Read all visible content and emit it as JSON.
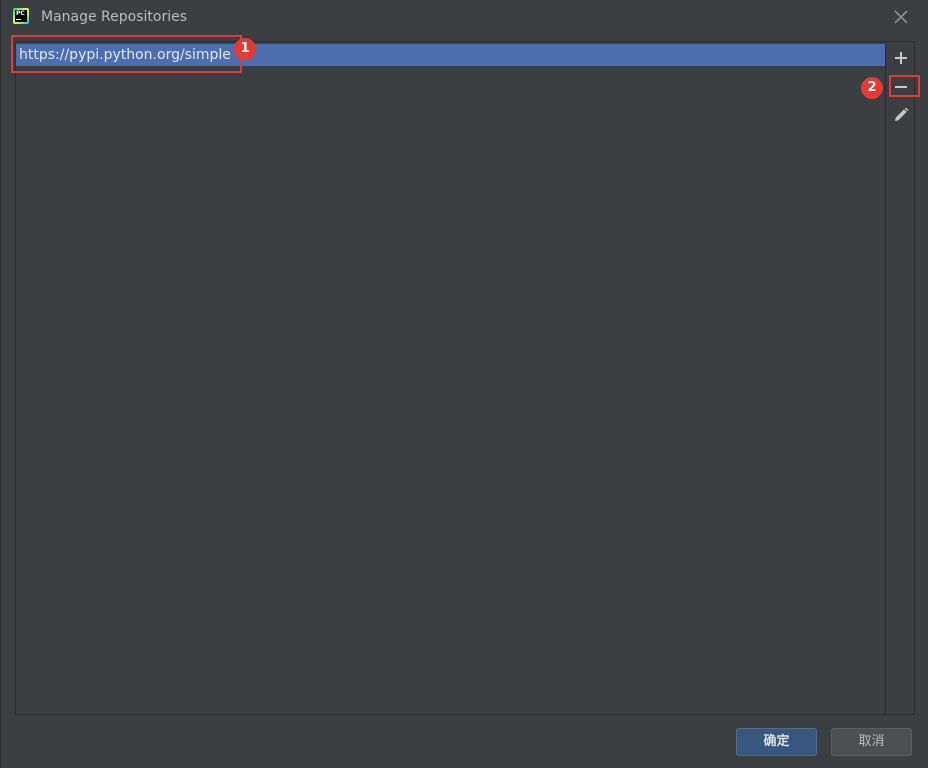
{
  "window": {
    "title": "Manage Repositories",
    "app_icon": "pycharm-icon",
    "close_icon": "close-icon"
  },
  "repositories": [
    {
      "url": "https://pypi.python.org/simple",
      "selected": true
    }
  ],
  "toolbar": {
    "add_icon": "plus-icon",
    "remove_icon": "minus-icon",
    "edit_icon": "pencil-icon"
  },
  "annotations": {
    "badge_1": "1",
    "badge_2": "2",
    "color": "#e53935"
  },
  "buttons": {
    "ok_label": "确定",
    "cancel_label": "取消"
  },
  "colors": {
    "background": "#3c3f41",
    "selection": "#4b6eaf",
    "primary_button": "#365880"
  }
}
